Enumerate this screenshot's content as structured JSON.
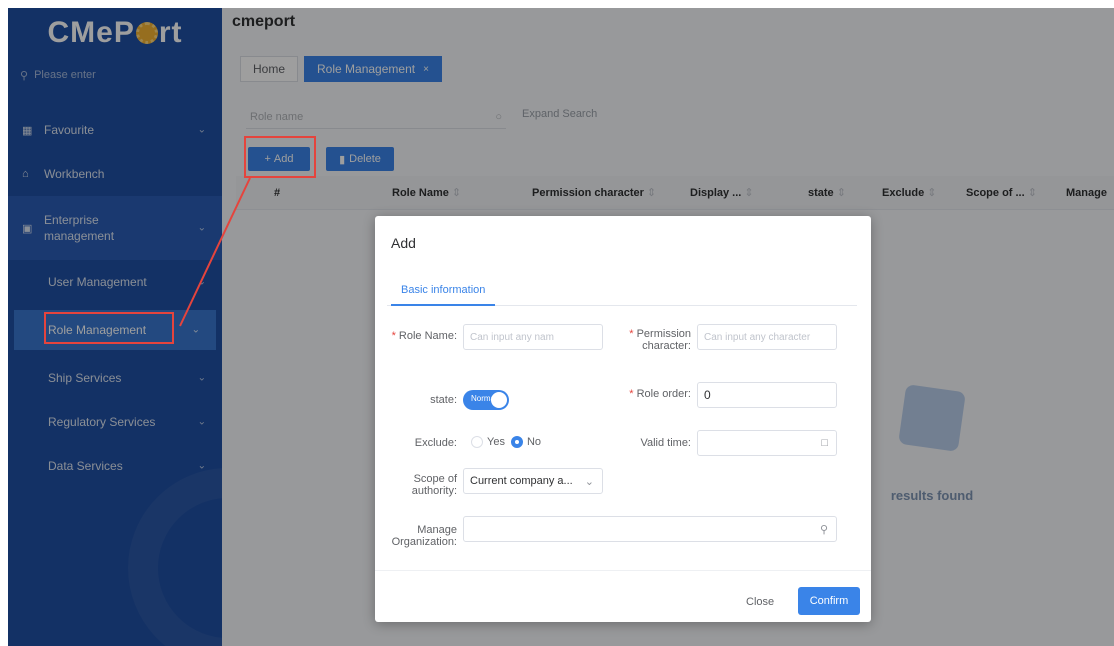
{
  "sidebar": {
    "logo": "CMeP●rt",
    "logo_parts": [
      "CMeP",
      "rt"
    ],
    "search_placeholder": "Please enter",
    "items": [
      {
        "label": "Favourite",
        "icon": "grid-icon"
      },
      {
        "label": "Workbench",
        "icon": "home-icon"
      },
      {
        "label": "Enterprise management",
        "icon": "building-icon"
      },
      {
        "label": "User Management"
      },
      {
        "label": "Role Management"
      },
      {
        "label": "Ship Services"
      },
      {
        "label": "Regulatory Services"
      },
      {
        "label": "Data Services"
      }
    ]
  },
  "header": {
    "app_title": "cmeport",
    "tabs": [
      {
        "label": "Home"
      },
      {
        "label": "Role Management"
      }
    ]
  },
  "toolbar": {
    "filter_placeholder": "Role name",
    "expand_search": "Expand Search",
    "add_label": "Add",
    "delete_label": "Delete"
  },
  "table": {
    "columns": [
      "#",
      "Role Name",
      "Permission character",
      "Display ...",
      "state",
      "Exclude",
      "Scope of ...",
      "Manage"
    ],
    "empty_text": "results found"
  },
  "dialog": {
    "title": "Add",
    "tab": "Basic information",
    "fields": {
      "role_name": {
        "label": "Role Name:",
        "placeholder": "Can input any nam"
      },
      "permission_character": {
        "label": "Permission character:",
        "placeholder": "Can input any character"
      },
      "state": {
        "label": "state:",
        "switch_text": "Normal",
        "value": true
      },
      "role_order": {
        "label": "Role order:",
        "value": "0"
      },
      "exclude": {
        "label": "Exclude:",
        "options": [
          "Yes",
          "No"
        ],
        "selected": "No"
      },
      "valid_time": {
        "label": "Valid time:",
        "placeholder": ""
      },
      "scope_of_authority": {
        "label": "Scope of authority:",
        "value": "Current company a..."
      },
      "manage_organization": {
        "label": "Manage Organization:",
        "placeholder": ""
      }
    },
    "close_label": "Close",
    "confirm_label": "Confirm"
  },
  "colors": {
    "sidebar_bg": "#1f4fa3",
    "accent": "#3a84e8",
    "highlight": "#e5443d"
  }
}
